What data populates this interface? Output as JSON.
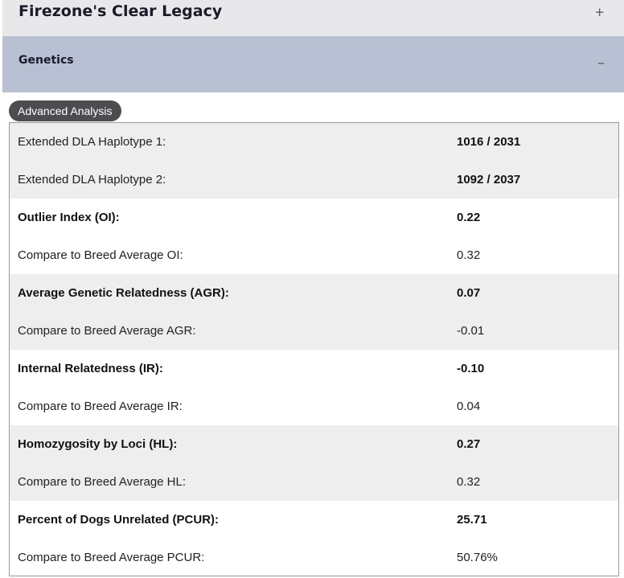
{
  "accordion": {
    "item1": {
      "title": "Firezone's Clear Legacy",
      "toggle": "+"
    },
    "item2": {
      "title": "Genetics",
      "toggle": "–"
    }
  },
  "badge": {
    "label": "Advanced Analysis"
  },
  "rows": [
    {
      "label": "Extended DLA Haplotype 1:",
      "value": "1016 / 2031"
    },
    {
      "label": "Extended DLA Haplotype 2:",
      "value": "1092 / 2037"
    },
    {
      "label": "Outlier Index (OI):",
      "value": "0.22"
    },
    {
      "label": "Compare to Breed Average OI:",
      "value": "0.32"
    },
    {
      "label": "Average Genetic Relatedness (AGR):",
      "value": "0.07"
    },
    {
      "label": "Compare to Breed Average AGR:",
      "value": "-0.01"
    },
    {
      "label": "Internal Relatedness (IR):",
      "value": "-0.10"
    },
    {
      "label": "Compare to Breed Average IR:",
      "value": "0.04"
    },
    {
      "label": "Homozygosity by Loci (HL):",
      "value": "0.27"
    },
    {
      "label": "Compare to Breed Average HL:",
      "value": "0.32"
    },
    {
      "label": "Percent of Dogs Unrelated (PCUR):",
      "value": "25.71"
    },
    {
      "label": "Compare to Breed Average PCUR:",
      "value": "50.76%"
    }
  ]
}
